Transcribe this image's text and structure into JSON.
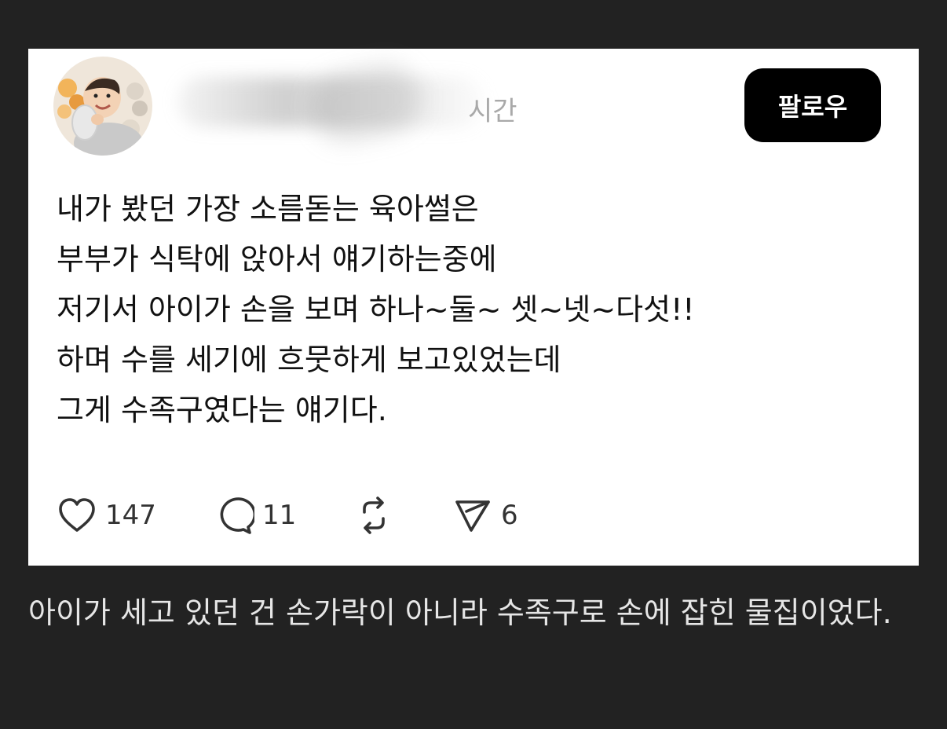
{
  "post": {
    "time_ago": "시간",
    "follow_label": "팔로우",
    "lines": [
      "내가 봤던 가장 소름돋는 육아썰은",
      "부부가 식탁에 앉아서 얘기하는중에",
      "저기서 아이가 손을 보며 하나~둘~ 셋~넷~다섯!!",
      "하며 수를 세기에 흐뭇하게 보고있었는데",
      "그게 수족구였다는 얘기다."
    ],
    "actions": {
      "likes": "147",
      "replies": "11",
      "shares": "6"
    }
  },
  "caption": "아이가 세고 있던 건 손가락이 아니라 수족구로 손에 잡힌 물집이었다.",
  "icons": [
    "heart-icon",
    "comment-icon",
    "repost-icon",
    "send-icon"
  ],
  "colors": {
    "page_background": "#222222",
    "card_background": "#ffffff",
    "follow_button": "#000000",
    "caption_text": "#e6e6e6"
  }
}
